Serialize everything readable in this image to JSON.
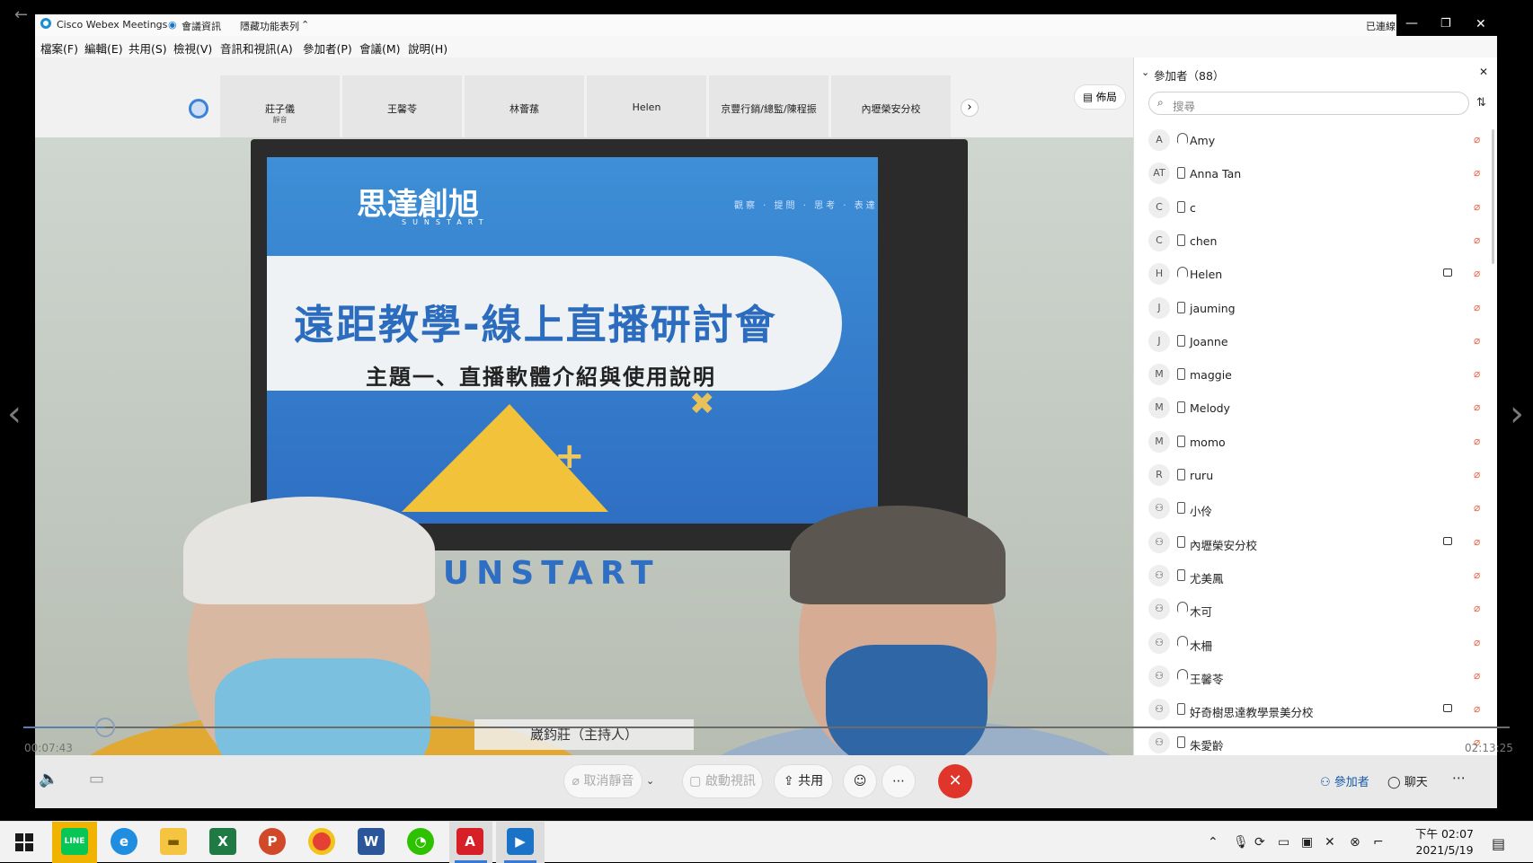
{
  "window": {
    "app_title": "Cisco Webex Meetings",
    "meeting_info_tab": "會議資訊",
    "hide_menu_toggle": "隱藏功能表列",
    "connection_status": "已連線"
  },
  "menu": [
    "檔案(F)",
    "編輯(E)",
    "共用(S)",
    "檢視(V)",
    "音訊和視訊(A)",
    "參加者(P)",
    "會議(M)",
    "說明(H)"
  ],
  "filmstrip": {
    "tiles": [
      {
        "name": "莊子儀",
        "sub": "靜音"
      },
      {
        "name": "王馨苓",
        "sub": ""
      },
      {
        "name": "林薈蓀",
        "sub": ""
      },
      {
        "name": "Helen",
        "sub": ""
      },
      {
        "name": "京豐行銷/總監/陳程振",
        "sub": ""
      },
      {
        "name": "內壢榮安分校",
        "sub": ""
      }
    ],
    "layout_button": "佈局"
  },
  "video": {
    "slide_logo": "思達創旭",
    "slide_logo_latin": "SUNSTART",
    "slide_tagline": "觀察 · 提問 · 思考 · 表達",
    "slide_title": "遠距教學-線上直播研討會",
    "slide_subtitle": "主題一、直播軟體介紹與使用說明",
    "wall_text": "SUNSTART",
    "speaker_label": "崴鈞莊（主持人）"
  },
  "controls": {
    "unmute": "取消靜音",
    "start_video": "啟動視訊",
    "share": "共用",
    "end_icon": "close-icon"
  },
  "panel": {
    "title": "參加者（88）",
    "search_placeholder": "搜尋",
    "participants_button": "參加者",
    "chat_button": "聊天",
    "participants": [
      {
        "initials": "A",
        "name": "Amy",
        "device": "audio",
        "video": false
      },
      {
        "initials": "AT",
        "name": "Anna Tan",
        "device": "phone",
        "video": false
      },
      {
        "initials": "C",
        "name": "c",
        "device": "phone",
        "video": false
      },
      {
        "initials": "C",
        "name": "chen",
        "device": "phone",
        "video": false
      },
      {
        "initials": "H",
        "name": "Helen",
        "device": "audio",
        "video": true
      },
      {
        "initials": "J",
        "name": "jauming",
        "device": "phone",
        "video": false
      },
      {
        "initials": "J",
        "name": "Joanne",
        "device": "phone",
        "video": false
      },
      {
        "initials": "M",
        "name": "maggie",
        "device": "phone",
        "video": false
      },
      {
        "initials": "M",
        "name": "Melody",
        "device": "phone",
        "video": false
      },
      {
        "initials": "M",
        "name": "momo",
        "device": "phone",
        "video": false
      },
      {
        "initials": "R",
        "name": "ruru",
        "device": "phone",
        "video": false
      },
      {
        "initials": "",
        "name": "小伶",
        "device": "phone",
        "video": false
      },
      {
        "initials": "",
        "name": "內壢榮安分校",
        "device": "phone",
        "video": true
      },
      {
        "initials": "",
        "name": "尤美鳳",
        "device": "phone",
        "video": false
      },
      {
        "initials": "",
        "name": "木可",
        "device": "audio",
        "video": false
      },
      {
        "initials": "",
        "name": "木柵",
        "device": "audio",
        "video": false
      },
      {
        "initials": "",
        "name": "王馨苓",
        "device": "audio",
        "video": false
      },
      {
        "initials": "",
        "name": "好奇樹思達教學景美分校",
        "device": "phone",
        "video": true
      },
      {
        "initials": "",
        "name": "朱愛齡",
        "device": "phone",
        "video": false
      }
    ]
  },
  "player": {
    "current_time": "00:07:43",
    "total_time": "02:13:25",
    "progress": 0.055
  },
  "taskbar": {
    "apps": [
      "LINE",
      "Edge",
      "Explorer",
      "Excel",
      "PowerPoint",
      "Chrome",
      "Word",
      "WeChat",
      "Acrobat",
      "Webex"
    ],
    "time": "下午 02:07",
    "date": "2021/5/19"
  },
  "colors": {
    "accent": "#2c6cbe",
    "end_red": "#e0352a",
    "mic_muted": "#e06a4a"
  }
}
